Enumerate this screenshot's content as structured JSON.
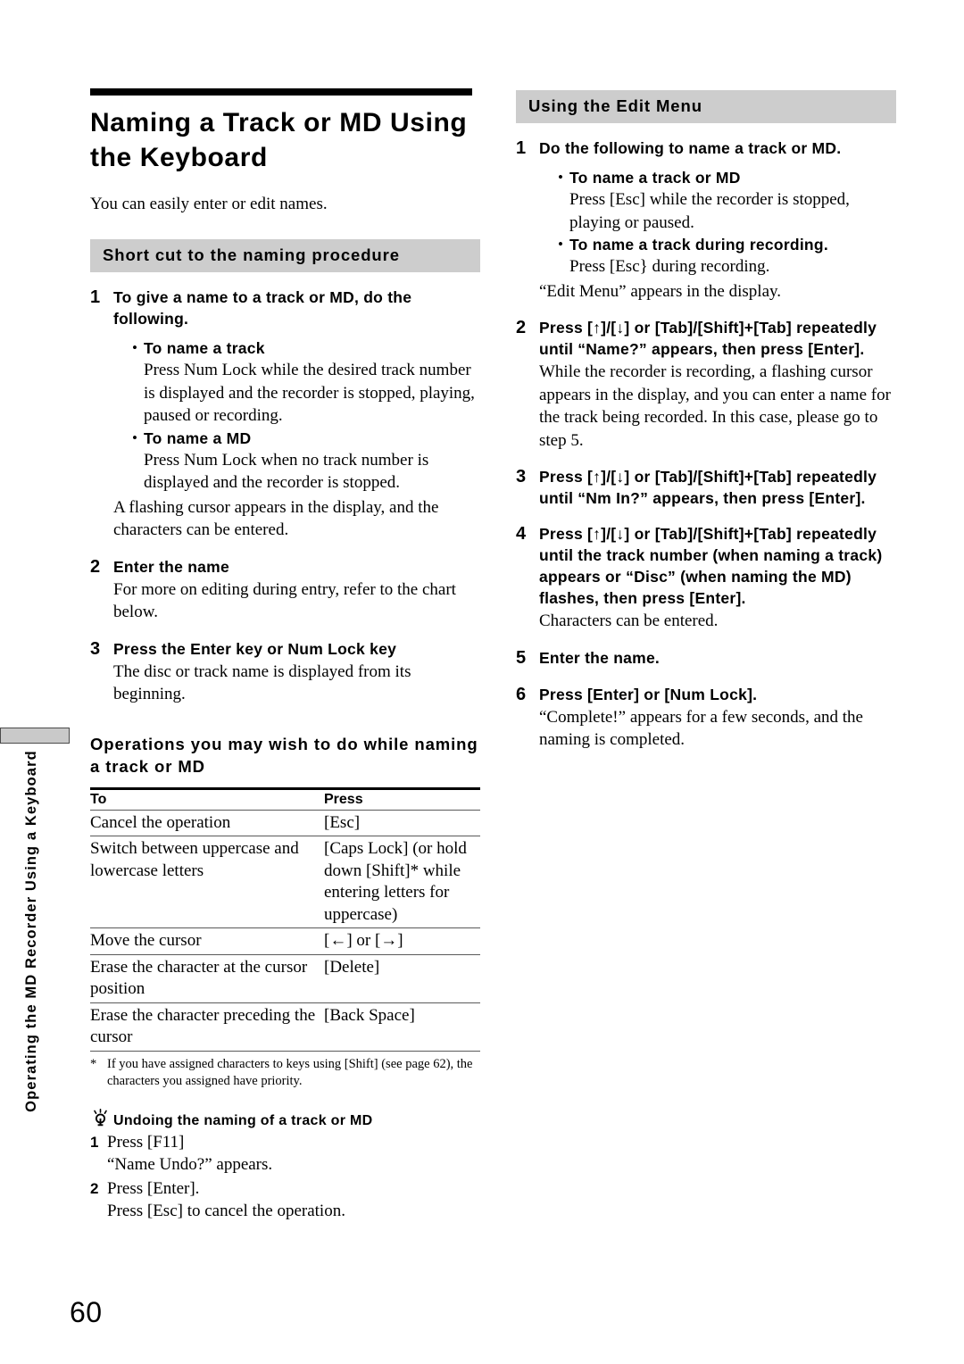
{
  "side_tab": {
    "label": "Operating the MD Recorder Using a Keyboard"
  },
  "page_number": "60",
  "left": {
    "title": "Naming a Track or MD Using the Keyboard",
    "intro": "You can easily enter or edit names.",
    "section_header": "Short cut to the naming procedure",
    "steps": [
      {
        "num": "1",
        "head": "To give a name to a track or MD, do the following.",
        "bullets": [
          {
            "head": "To name a track",
            "text": "Press Num Lock while the desired track number is displayed and the recorder is stopped, playing, paused or recording."
          },
          {
            "head": "To name a MD",
            "text": "Press Num Lock when no track number is displayed and the recorder is stopped."
          }
        ],
        "after": "A flashing cursor appears in the display, and the characters can be entered."
      },
      {
        "num": "2",
        "head": "Enter the name",
        "text": "For more on editing during entry, refer to the chart below."
      },
      {
        "num": "3",
        "head": "Press the Enter key or Num Lock key",
        "text": "The disc or track name is displayed from its beginning."
      }
    ],
    "table_heading": "Operations you may wish to do while naming a track or MD",
    "table": {
      "columns": [
        "To",
        "Press"
      ],
      "rows": [
        [
          "Cancel the operation",
          "[Esc]"
        ],
        [
          "Switch between uppercase and lowercase letters",
          "[Caps Lock] (or hold down [Shift]* while entering letters for uppercase)"
        ],
        [
          "Move the cursor",
          "[←] or [→]"
        ],
        [
          "Erase the character at the cursor position",
          "[Delete]"
        ],
        [
          "Erase the character preceding the cursor",
          "[Back Space]"
        ]
      ]
    },
    "footnote": {
      "mark": "*",
      "text": "If you have assigned characters to keys using [Shift] (see page 62), the characters you assigned have priority."
    },
    "tip": {
      "icon": "light-bulb-icon",
      "head": "Undoing the naming of a track or MD",
      "steps": [
        {
          "num": "1",
          "text": "Press [F11]",
          "sub": "“Name Undo?” appears."
        },
        {
          "num": "2",
          "text": "Press [Enter].",
          "sub": "Press [Esc] to cancel the operation."
        }
      ]
    }
  },
  "right": {
    "section_header": "Using the Edit Menu",
    "steps": [
      {
        "num": "1",
        "head": "Do the following to name a track or MD.",
        "bullets": [
          {
            "head": "To name a track or MD",
            "text": "Press [Esc] while the recorder is stopped, playing or paused."
          },
          {
            "head": "To name a track during recording.",
            "text": "Press [Esc} during recording."
          }
        ],
        "after": "“Edit Menu” appears in the display."
      },
      {
        "num": "2",
        "head": "Press [↑]/[↓] or [Tab]/[Shift]+[Tab] repeatedly until “Name?” appears, then press [Enter].",
        "text": "While the recorder is recording, a flashing cursor appears in the display, and you can enter a name for the track being recorded. In this case, please go to step 5."
      },
      {
        "num": "3",
        "head": "Press [↑]/[↓] or [Tab]/[Shift]+[Tab] repeatedly until “Nm In?” appears, then press [Enter]."
      },
      {
        "num": "4",
        "head": "Press [↑]/[↓] or [Tab]/[Shift]+[Tab] repeatedly until the track number (when naming a track) appears or “Disc” (when naming the MD) flashes, then press [Enter].",
        "text": "Characters can be entered."
      },
      {
        "num": "5",
        "head": "Enter the name."
      },
      {
        "num": "6",
        "head": "Press [Enter] or [Num Lock].",
        "text": "“Complete!” appears for a few seconds, and the naming is completed."
      }
    ]
  }
}
